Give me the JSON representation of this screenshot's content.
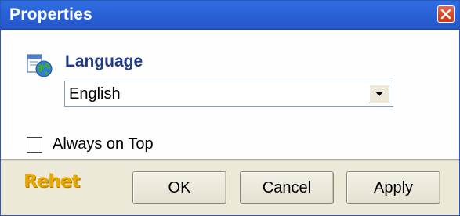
{
  "window": {
    "title": "Properties",
    "close_icon": "close-icon"
  },
  "language": {
    "icon": "language-globe-icon",
    "label": "Language",
    "selected": "English",
    "dropdown_icon": "chevron-down-icon"
  },
  "options": {
    "always_on_top_label": "Always on Top",
    "always_on_top_checked": false
  },
  "footer": {
    "logo_text": "Rehet",
    "ok_label": "OK",
    "cancel_label": "Cancel",
    "apply_label": "Apply"
  },
  "colors": {
    "titlebar": "#2a62d8",
    "close_button": "#d9441f",
    "label_accent": "#1f3a8c",
    "logo": "#e8a800",
    "dialog_face": "#ece9d8"
  }
}
